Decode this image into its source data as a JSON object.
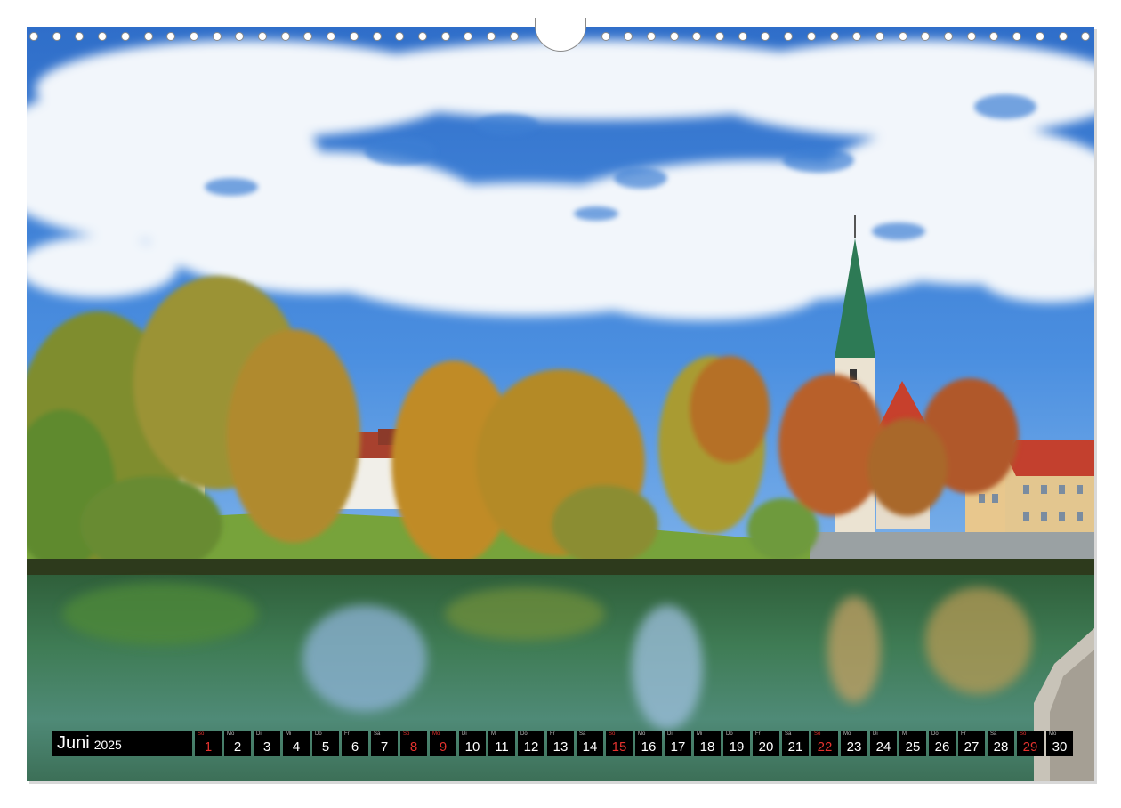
{
  "calendar": {
    "month": "Juni",
    "year": "2025",
    "days": [
      {
        "wd": "So",
        "num": "1",
        "sunday": true
      },
      {
        "wd": "Mo",
        "num": "2",
        "sunday": false
      },
      {
        "wd": "Di",
        "num": "3",
        "sunday": false
      },
      {
        "wd": "Mi",
        "num": "4",
        "sunday": false
      },
      {
        "wd": "Do",
        "num": "5",
        "sunday": false
      },
      {
        "wd": "Fr",
        "num": "6",
        "sunday": false
      },
      {
        "wd": "Sa",
        "num": "7",
        "sunday": false
      },
      {
        "wd": "So",
        "num": "8",
        "sunday": true
      },
      {
        "wd": "Mo",
        "num": "9",
        "sunday": true
      },
      {
        "wd": "Di",
        "num": "10",
        "sunday": false
      },
      {
        "wd": "Mi",
        "num": "11",
        "sunday": false
      },
      {
        "wd": "Do",
        "num": "12",
        "sunday": false
      },
      {
        "wd": "Fr",
        "num": "13",
        "sunday": false
      },
      {
        "wd": "Sa",
        "num": "14",
        "sunday": false
      },
      {
        "wd": "So",
        "num": "15",
        "sunday": true
      },
      {
        "wd": "Mo",
        "num": "16",
        "sunday": false
      },
      {
        "wd": "Di",
        "num": "17",
        "sunday": false
      },
      {
        "wd": "Mi",
        "num": "18",
        "sunday": false
      },
      {
        "wd": "Do",
        "num": "19",
        "sunday": false
      },
      {
        "wd": "Fr",
        "num": "20",
        "sunday": false
      },
      {
        "wd": "Sa",
        "num": "21",
        "sunday": false
      },
      {
        "wd": "So",
        "num": "22",
        "sunday": true
      },
      {
        "wd": "Mo",
        "num": "23",
        "sunday": false
      },
      {
        "wd": "Di",
        "num": "24",
        "sunday": false
      },
      {
        "wd": "Mi",
        "num": "25",
        "sunday": false
      },
      {
        "wd": "Do",
        "num": "26",
        "sunday": false
      },
      {
        "wd": "Fr",
        "num": "27",
        "sunday": false
      },
      {
        "wd": "Sa",
        "num": "28",
        "sunday": false
      },
      {
        "wd": "So",
        "num": "29",
        "sunday": true
      },
      {
        "wd": "Mo",
        "num": "30",
        "sunday": false
      }
    ]
  },
  "colors": {
    "sky": "#3b7fd6",
    "cloud": "#f4f7fb",
    "water": "#3f7a55",
    "sunday_red": "#e3322e",
    "strip_bg": "#000000"
  }
}
